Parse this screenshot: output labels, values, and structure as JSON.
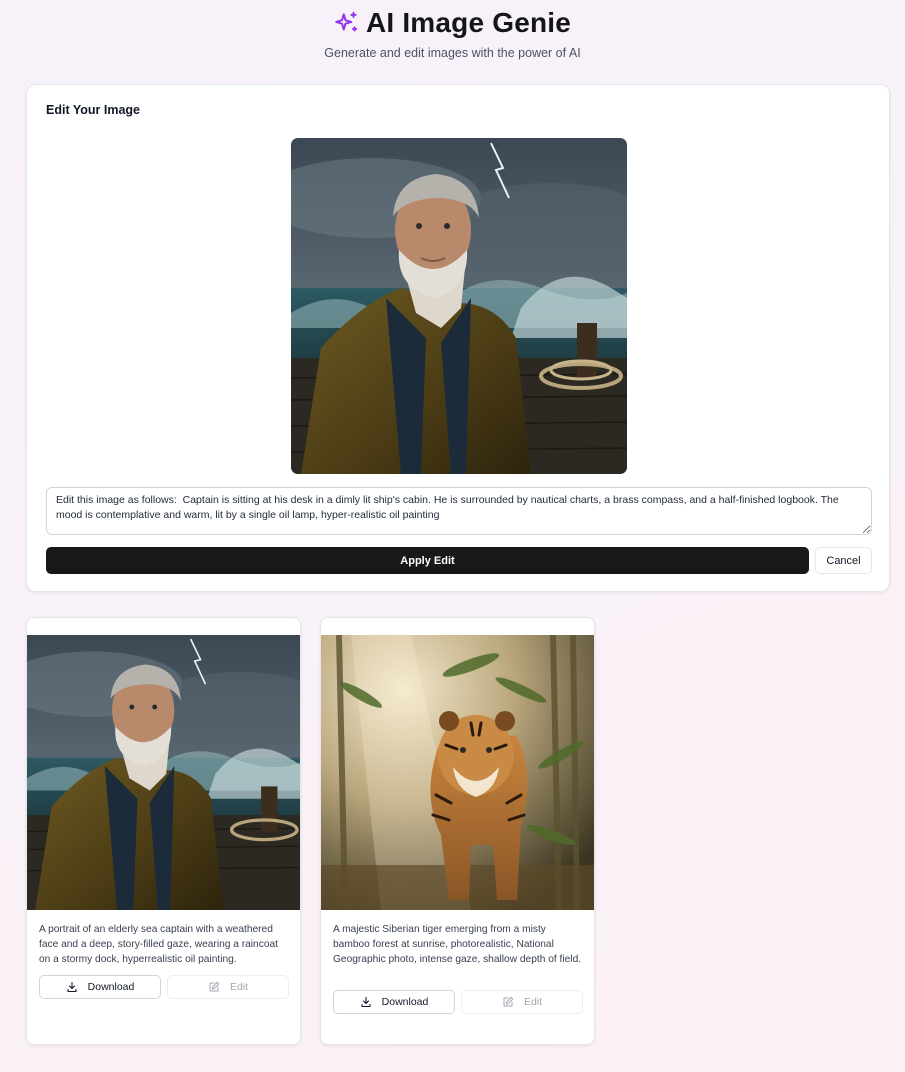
{
  "header": {
    "title": "AI Image Genie",
    "subtitle": "Generate and edit images with the power of AI",
    "icon": "sparkles-icon",
    "accent_color": "#9333ea"
  },
  "editor": {
    "title": "Edit Your Image",
    "prompt_value": "Edit this image as follows:  Captain is sitting at his desk in a dimly lit ship's cabin. He is surrounded by nautical charts, a brass compass, and a half-finished logbook. The mood is contemplative and warm, lit by a single oil lamp, hyper-realistic oil painting",
    "apply_label": "Apply Edit",
    "cancel_label": "Cancel"
  },
  "gallery": [
    {
      "image": "sea-captain-painting",
      "caption": "A portrait of an elderly sea captain with a weathered face and a deep, story-filled gaze, wearing a raincoat on a stormy dock, hyperrealistic oil painting.",
      "download_label": "Download",
      "edit_label": "Edit"
    },
    {
      "image": "siberian-tiger-photo",
      "caption": "A majestic Siberian tiger emerging from a misty bamboo forest at sunrise, photorealistic, National Geographic photo, intense gaze, shallow depth of field.",
      "download_label": "Download",
      "edit_label": "Edit"
    }
  ],
  "icons": {
    "download": "download-icon",
    "edit": "pencil-square-icon"
  }
}
